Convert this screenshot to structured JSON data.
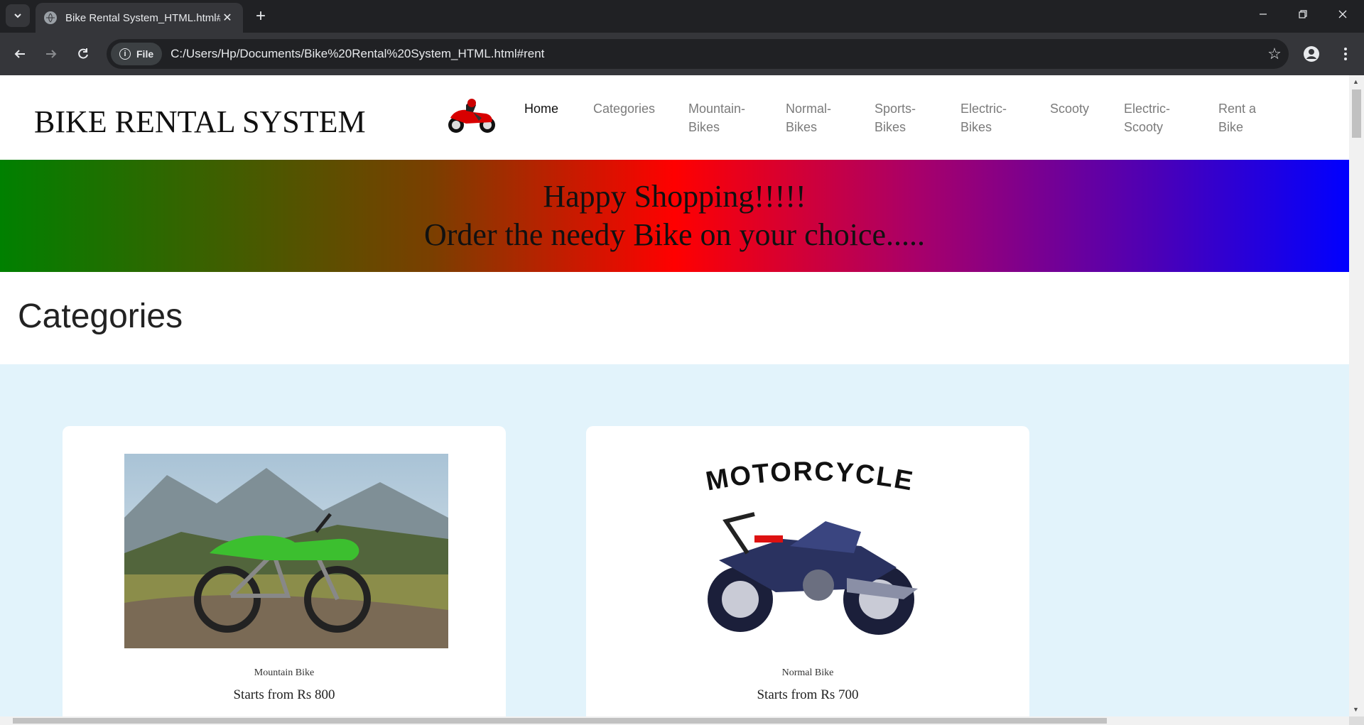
{
  "browser": {
    "tab_title": "Bike Rental System_HTML.html#",
    "address_chip": "File",
    "url": "C:/Users/Hp/Documents/Bike%20Rental%20System_HTML.html#rent"
  },
  "site": {
    "brand": "BIKE RENTAL SYSTEM",
    "nav": [
      {
        "label": "Home"
      },
      {
        "label": "Categories"
      },
      {
        "label": "Mountain-Bikes"
      },
      {
        "label": "Normal-Bikes"
      },
      {
        "label": "Sports-Bikes"
      },
      {
        "label": "Electric-Bikes"
      },
      {
        "label": "Scooty"
      },
      {
        "label": "Electric-Scooty"
      },
      {
        "label": "Rent a Bike"
      }
    ]
  },
  "banner": {
    "line1": "Happy Shopping!!!!!",
    "line2": "Order the needy Bike on your choice....."
  },
  "categories": {
    "title": "Categories",
    "cards": [
      {
        "name": "Mountain Bike",
        "price": "Starts from Rs 800"
      },
      {
        "name": "Normal Bike",
        "price": "Starts from Rs 700",
        "image_caption": "MOTORCYCLE"
      }
    ]
  },
  "colors": {
    "cards_bg": "#e2f3fb",
    "banner_start": "#008000",
    "banner_mid": "#ff0000",
    "banner_end": "#0000ff"
  }
}
